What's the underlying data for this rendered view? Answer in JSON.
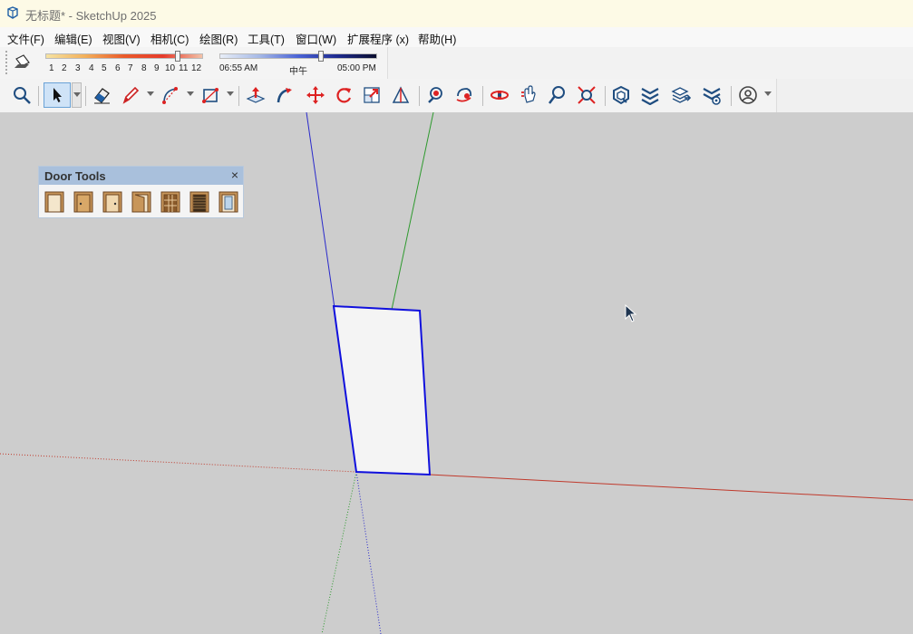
{
  "window": {
    "title": "无标题* - SketchUp 2025"
  },
  "menu": [
    "文件(F)",
    "编辑(E)",
    "视图(V)",
    "相机(C)",
    "绘图(R)",
    "工具(T)",
    "窗口(W)",
    "扩展程序 (x)",
    "帮助(H)"
  ],
  "shadows": {
    "month_ticks": [
      "1",
      "2",
      "3",
      "4",
      "5",
      "6",
      "7",
      "8",
      "9",
      "10",
      "11",
      "12"
    ],
    "selected_month": 11,
    "time_start": "06:55 AM",
    "time_mid": "中午",
    "time_end": "05:00 PM",
    "time_position": 0.65
  },
  "door_tools": {
    "title": "Door Tools",
    "close": "×",
    "icons": [
      "door-frame-icon",
      "door-single-icon",
      "door-handle-icon",
      "door-open-frame-icon",
      "door-paneled-icon",
      "door-louver-icon",
      "door-glass-icon"
    ]
  },
  "toolbar_icons": [
    "search-icon",
    "select-icon",
    "eraser-icon",
    "pencil-icon",
    "arc-icon",
    "rectangle-icon",
    "push-pull-icon",
    "follow-me-icon",
    "move-icon",
    "rotate-icon",
    "scale-icon",
    "tape-measure-icon",
    "paint-bucket-icon",
    "orbit-icon",
    "pan-icon",
    "walk-icon",
    "zoom-icon",
    "zoom-extents-icon",
    "warehouse-icon",
    "extension-warehouse-icon",
    "layout-icon",
    "extension-manager-icon",
    "account-icon"
  ],
  "colors": {
    "axis_blue": "#2a2acb",
    "axis_green": "#2e9a2e",
    "axis_red": "#c0392b",
    "selection": "#1010dd"
  }
}
